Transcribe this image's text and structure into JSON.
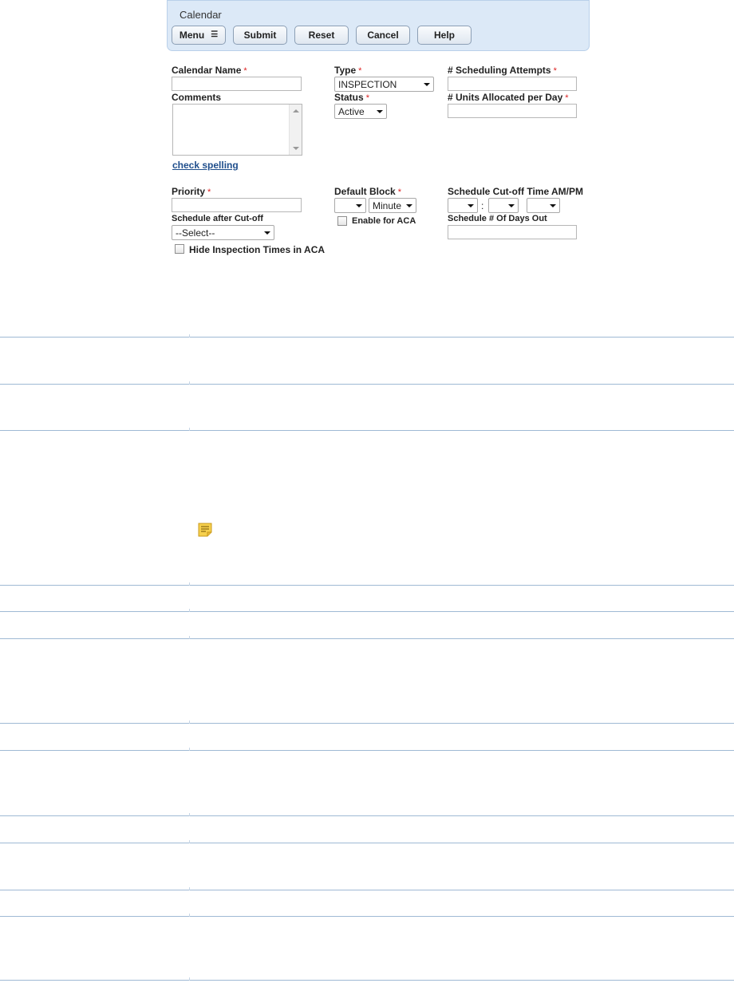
{
  "header": {
    "title": "Calendar",
    "buttons": {
      "menu": "Menu",
      "submit": "Submit",
      "reset": "Reset",
      "cancel": "Cancel",
      "help": "Help"
    }
  },
  "form": {
    "calendar_name": {
      "label": "Calendar Name",
      "value": ""
    },
    "type": {
      "label": "Type",
      "value": "INSPECTION"
    },
    "scheduling_attempts": {
      "label": "# Scheduling Attempts",
      "value": ""
    },
    "comments": {
      "label": "Comments",
      "value": ""
    },
    "status": {
      "label": "Status",
      "value": "Active"
    },
    "units_allocated": {
      "label": "# Units Allocated per Day",
      "value": ""
    },
    "check_spelling": "check spelling",
    "priority": {
      "label": "Priority",
      "value": ""
    },
    "default_block": {
      "label": "Default Block",
      "value": "",
      "unit": "Minute"
    },
    "schedule_cutoff_time": {
      "label": "Schedule Cut-off Time  AM/PM",
      "hour": "",
      "minute": "",
      "ampm": "",
      "separator": ":"
    },
    "schedule_after_cutoff": {
      "label": "Schedule after Cut-off",
      "value": "--Select--"
    },
    "enable_for_aca": {
      "label": "Enable for ACA",
      "checked": false
    },
    "schedule_days_out": {
      "label": "Schedule # Of Days Out",
      "value": ""
    },
    "hide_inspection_times": {
      "label": "Hide Inspection Times in ACA",
      "checked": false
    },
    "required_marker": "*"
  },
  "icons": {
    "menu": "menu-lines-icon",
    "note": "note-icon"
  },
  "colors": {
    "panel_bg": "#dce9f7",
    "rule": "#9fb9d4",
    "required": "#d22222",
    "link": "#1f4e8c"
  }
}
